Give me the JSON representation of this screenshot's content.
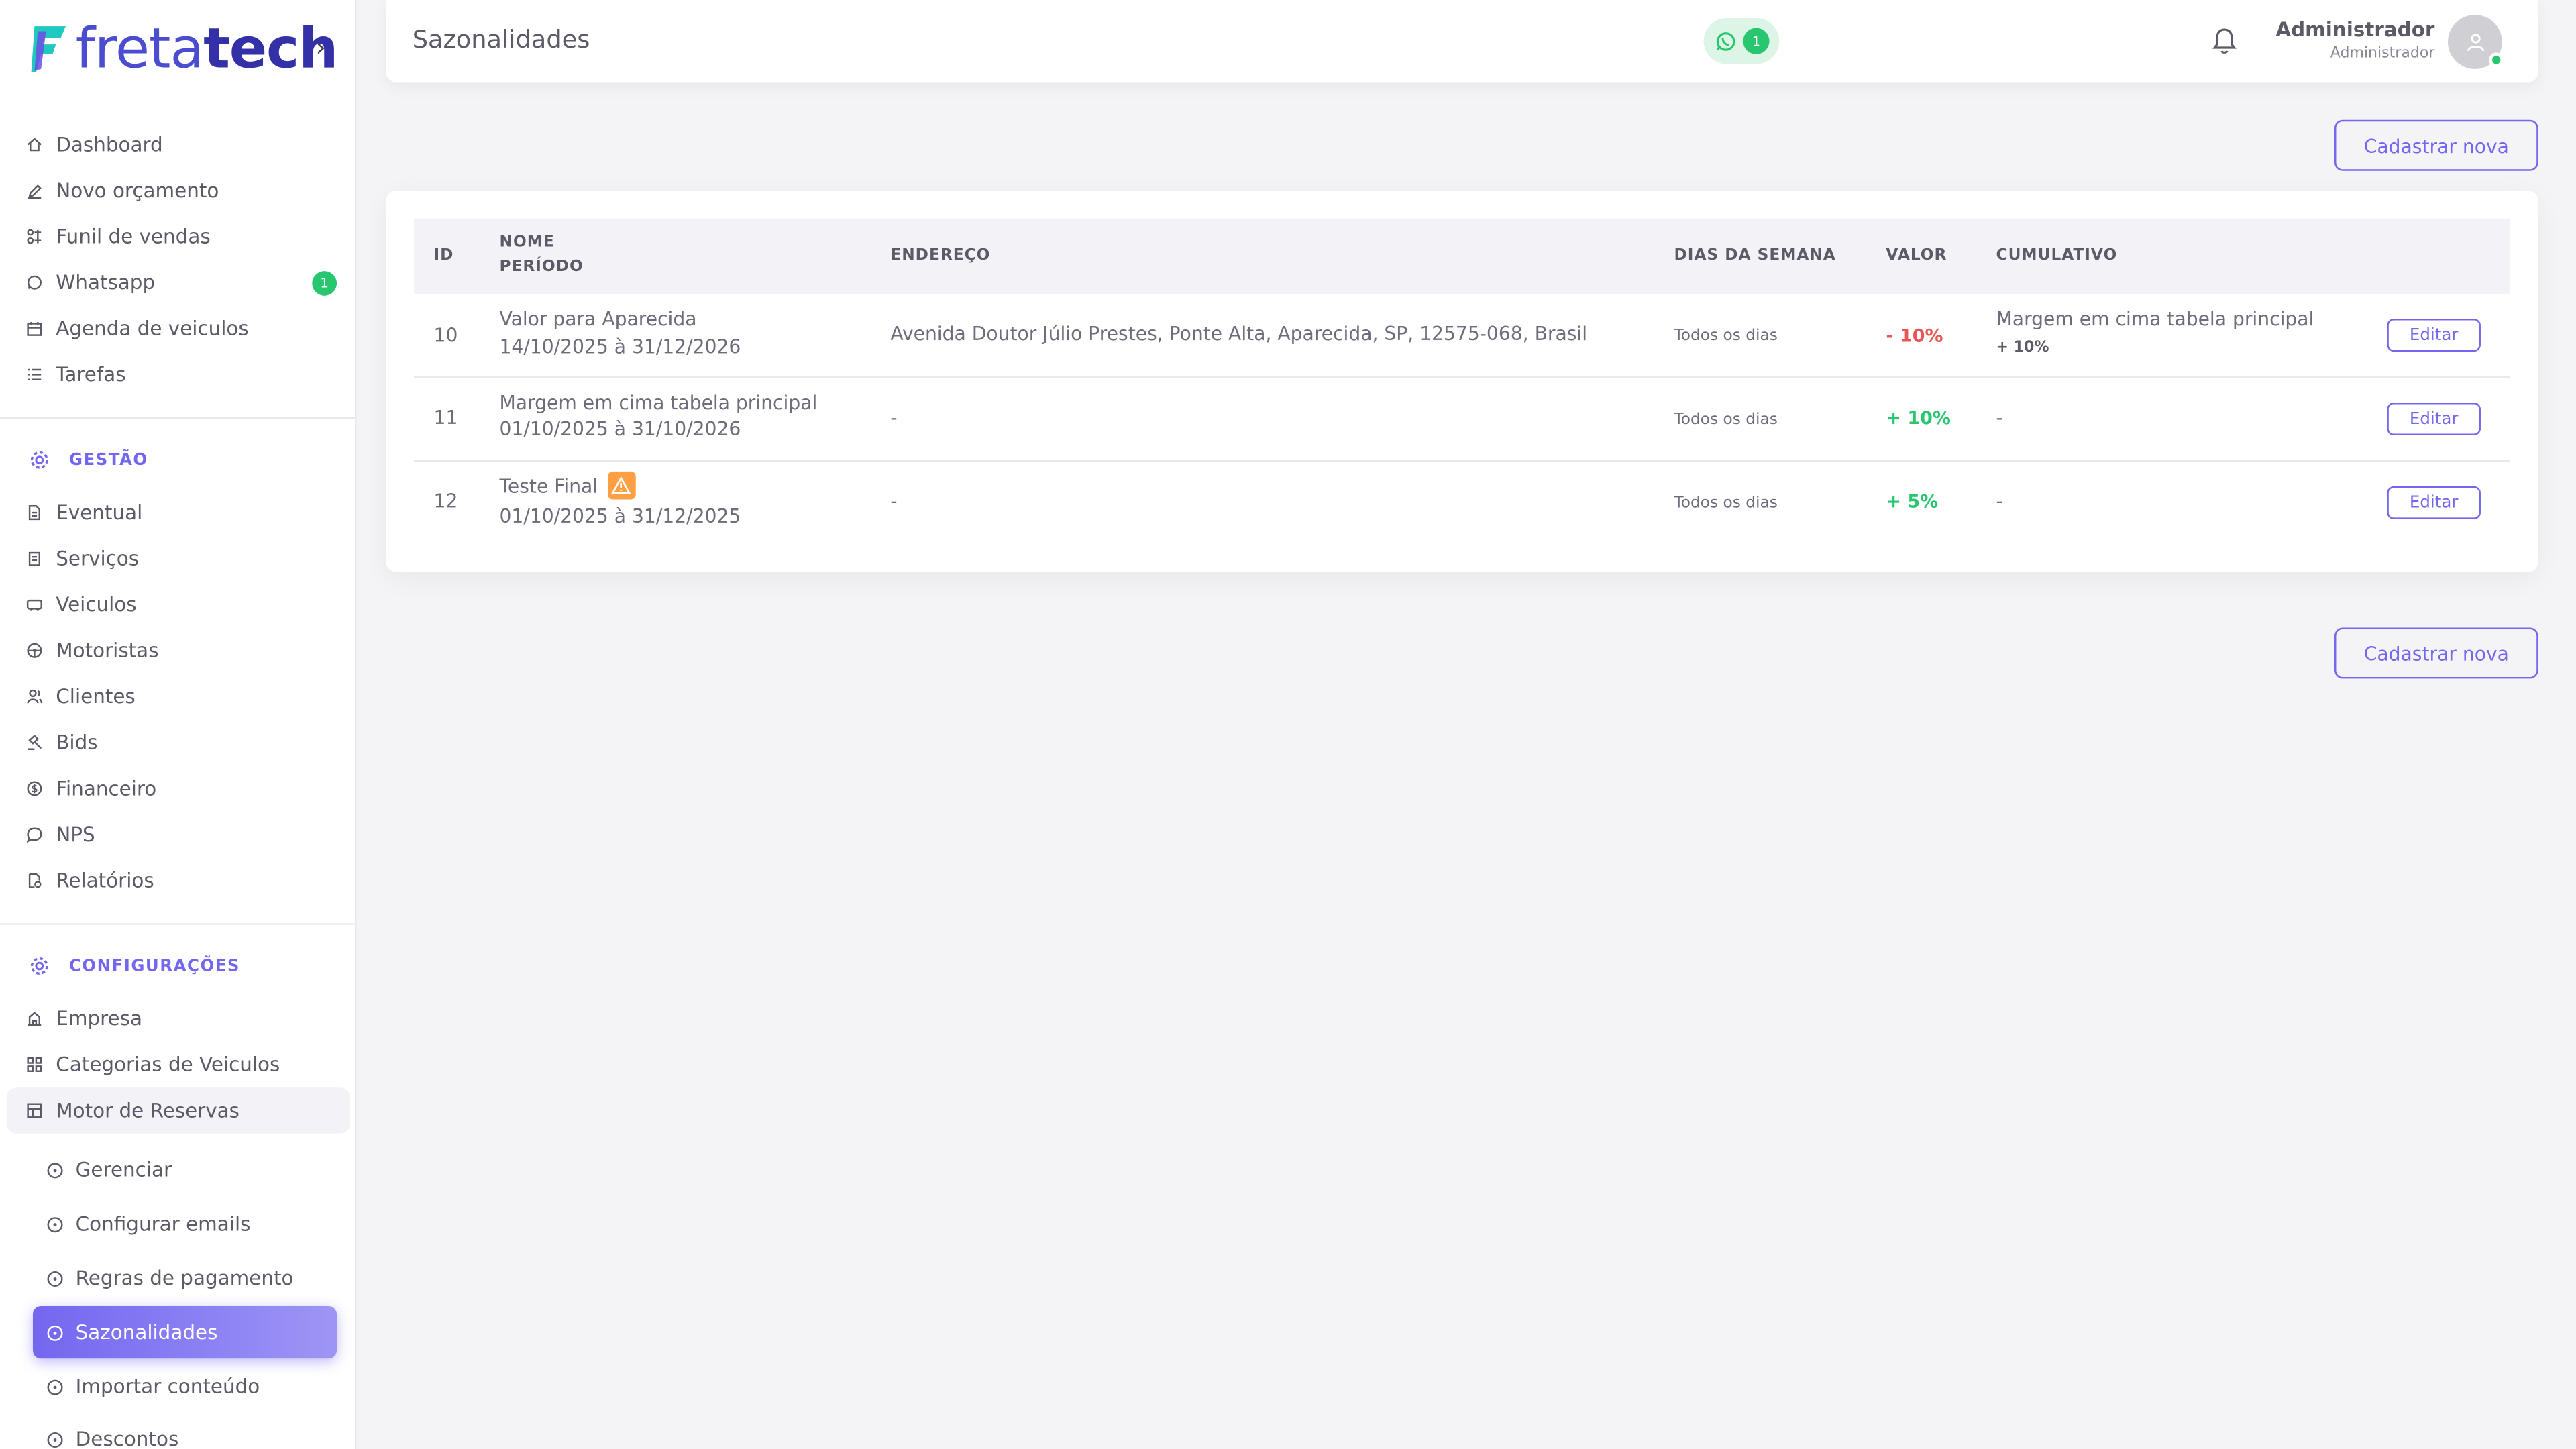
{
  "logo": {
    "text_main": "freta",
    "text_bold": "tech"
  },
  "sidebar": {
    "items": [
      {
        "label": "Dashboard",
        "icon": "home-icon"
      },
      {
        "label": "Novo orçamento",
        "icon": "edit-icon"
      },
      {
        "label": "Funil de vendas",
        "icon": "funnel-icon"
      },
      {
        "label": "Whatsapp",
        "icon": "whatsapp-icon",
        "badge": "1"
      },
      {
        "label": "Agenda de veiculos",
        "icon": "calendar-icon"
      },
      {
        "label": "Tarefas",
        "icon": "list-icon"
      }
    ],
    "gestao": {
      "title": "GESTÃO",
      "items": [
        {
          "label": "Eventual",
          "icon": "document-icon"
        },
        {
          "label": "Serviços",
          "icon": "clipboard-icon"
        },
        {
          "label": "Veiculos",
          "icon": "bus-icon"
        },
        {
          "label": "Motoristas",
          "icon": "steering-wheel-icon"
        },
        {
          "label": "Clientes",
          "icon": "users-icon"
        },
        {
          "label": "Bids",
          "icon": "gavel-icon"
        },
        {
          "label": "Financeiro",
          "icon": "coin-icon"
        },
        {
          "label": "NPS",
          "icon": "chat-icon"
        },
        {
          "label": "Relatórios",
          "icon": "report-icon"
        }
      ]
    },
    "config": {
      "title": "CONFIGURAÇÕES",
      "items": [
        {
          "label": "Empresa",
          "icon": "building-icon"
        },
        {
          "label": "Categorias de Veiculos",
          "icon": "grid-icon"
        },
        {
          "label": "Motor de Reservas",
          "icon": "table-icon"
        }
      ],
      "sub_items": [
        {
          "label": "Gerenciar"
        },
        {
          "label": "Configurar emails"
        },
        {
          "label": "Regras de pagamento"
        },
        {
          "label": "Sazonalidades"
        },
        {
          "label": "Importar conteúdo"
        },
        {
          "label": "Descontos"
        }
      ]
    }
  },
  "header": {
    "title": "Sazonalidades",
    "whatsapp_count": "1",
    "user_name": "Administrador",
    "user_role": "Administrador"
  },
  "actions": {
    "new_label": "Cadastrar nova"
  },
  "table": {
    "headers": {
      "id": "ID",
      "nome": "NOME",
      "periodo": "PERÍODO",
      "endereco": "ENDEREÇO",
      "dias": "DIAS DA SEMANA",
      "valor": "VALOR",
      "cumulativo": "CUMULATIVO"
    },
    "rows": [
      {
        "id": "10",
        "nome": "Valor para Aparecida",
        "periodo": "14/10/2025 à 31/12/2026",
        "endereco": "Avenida Doutor Júlio Prestes, Ponte Alta, Aparecida, SP, 12575-068, Brasil",
        "dias": "Todos os dias",
        "valor": "- 10%",
        "cumulativo": "Margem em cima tabela principal",
        "cumulativo_sub": "+ 10%",
        "edit": "Editar"
      },
      {
        "id": "11",
        "nome": "Margem em cima tabela principal",
        "periodo": "01/10/2025 à 31/10/2026",
        "endereco": "-",
        "dias": "Todos os dias",
        "valor": "+ 10%",
        "cumulativo": "-",
        "edit": "Editar"
      },
      {
        "id": "12",
        "nome": "Teste Final",
        "periodo": "01/10/2025 à 31/12/2025",
        "endereco": "-",
        "dias": "Todos os dias",
        "valor": "+ 5%",
        "cumulativo": "-",
        "edit": "Editar",
        "warning": true
      }
    ]
  },
  "colors": {
    "accent": "#7367f0",
    "success": "#28c76f",
    "danger": "#ea5455",
    "warning": "#ff9f43"
  }
}
